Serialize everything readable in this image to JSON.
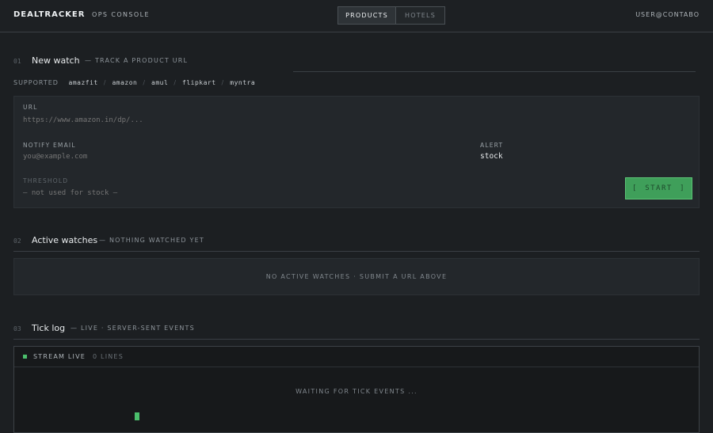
{
  "header": {
    "brand": "DEALTRACKER",
    "separator": "·",
    "console": "OPS CONSOLE",
    "tabs": [
      {
        "label": "PRODUCTS",
        "active": true
      },
      {
        "label": "HOTELS",
        "active": false
      }
    ],
    "user": "USER@CONTABO"
  },
  "new_watch": {
    "number": "01",
    "title": "New watch",
    "subtitle": "— TRACK A PRODUCT URL",
    "supported_label": "SUPPORTED",
    "stores": [
      "amazfit",
      "amazon",
      "amul",
      "flipkart",
      "myntra"
    ],
    "store_separator": "/",
    "url_label": "URL",
    "url_placeholder": "https://www.amazon.in/dp/...",
    "email_label": "NOTIFY EMAIL",
    "email_placeholder": "you@example.com",
    "alert_label": "ALERT",
    "alert_value": "stock",
    "threshold_label": "THRESHOLD",
    "threshold_placeholder": "— not used for stock —",
    "start_label": "START",
    "start_bracket_left": "[",
    "start_bracket_right": "]"
  },
  "active_watches": {
    "number": "02",
    "title": "Active watches",
    "subtitle": "— NOTHING WATCHED YET",
    "empty_text": "NO ACTIVE WATCHES · SUBMIT A URL ABOVE"
  },
  "tick_log": {
    "number": "03",
    "title": "Tick log",
    "subtitle": "— LIVE · SERVER-SENT EVENTS",
    "stream_label": "STREAM LIVE",
    "lines_label": "0 LINES",
    "waiting_text": "WAITING FOR TICK EVENTS ..."
  },
  "colors": {
    "accent_green": "#3f9f5a",
    "live_green": "#4bbf6c",
    "background": "#1c1f22"
  }
}
